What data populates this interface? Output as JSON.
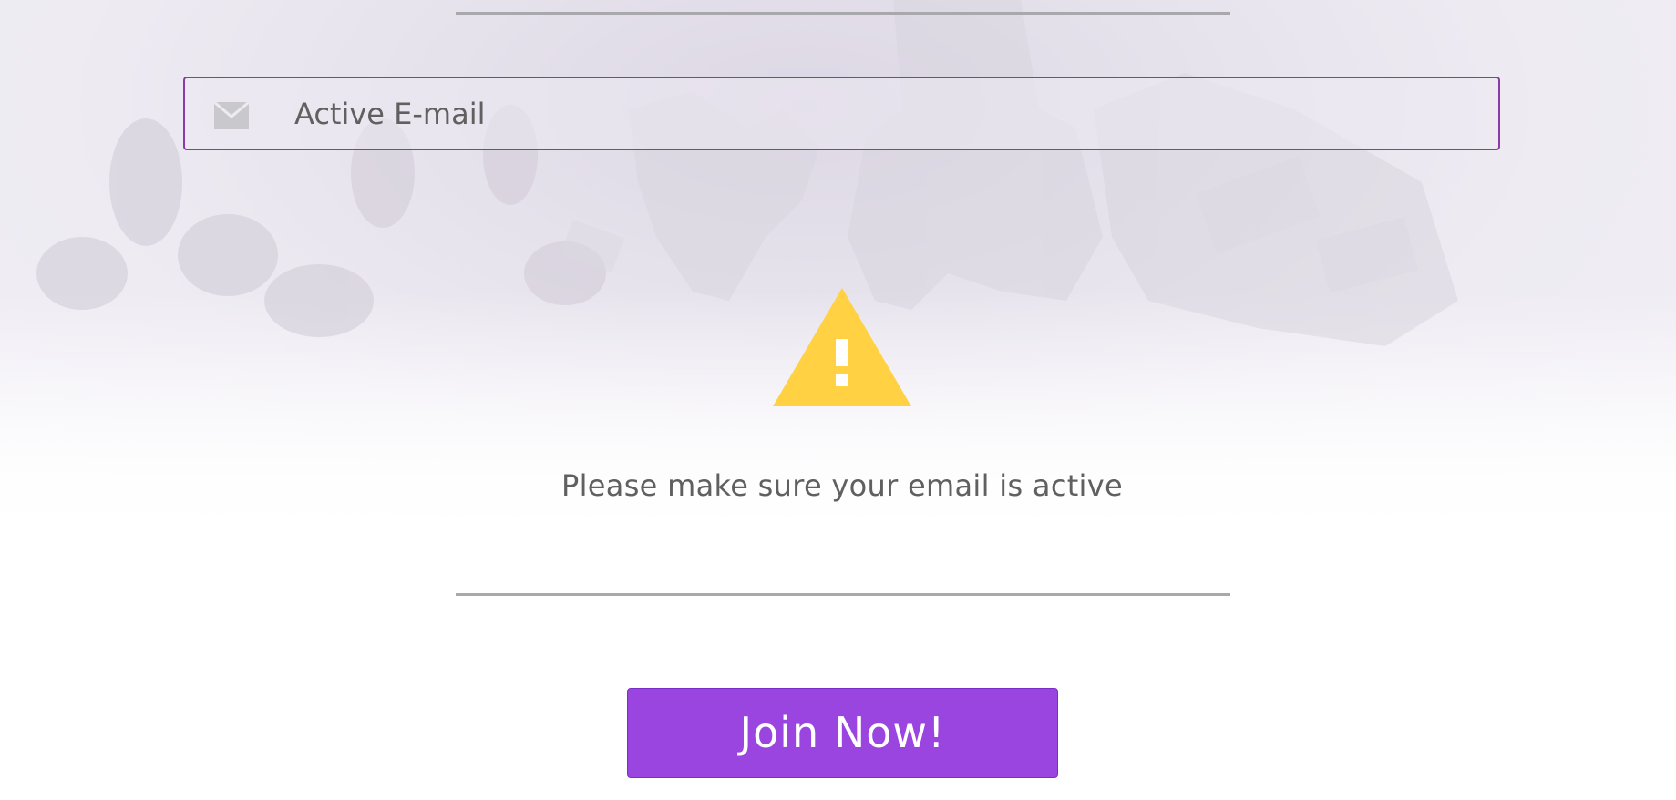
{
  "email_field": {
    "placeholder": "Active E-mail",
    "icon": "mail-icon"
  },
  "notice": {
    "icon": "warning-icon",
    "text": "Please make sure your email is active"
  },
  "join_button": {
    "label": "Join Now!"
  },
  "colors": {
    "accent": "#9b45e0",
    "field_border": "#8e3aa6",
    "warning": "#ffd143",
    "text": "#606060"
  }
}
